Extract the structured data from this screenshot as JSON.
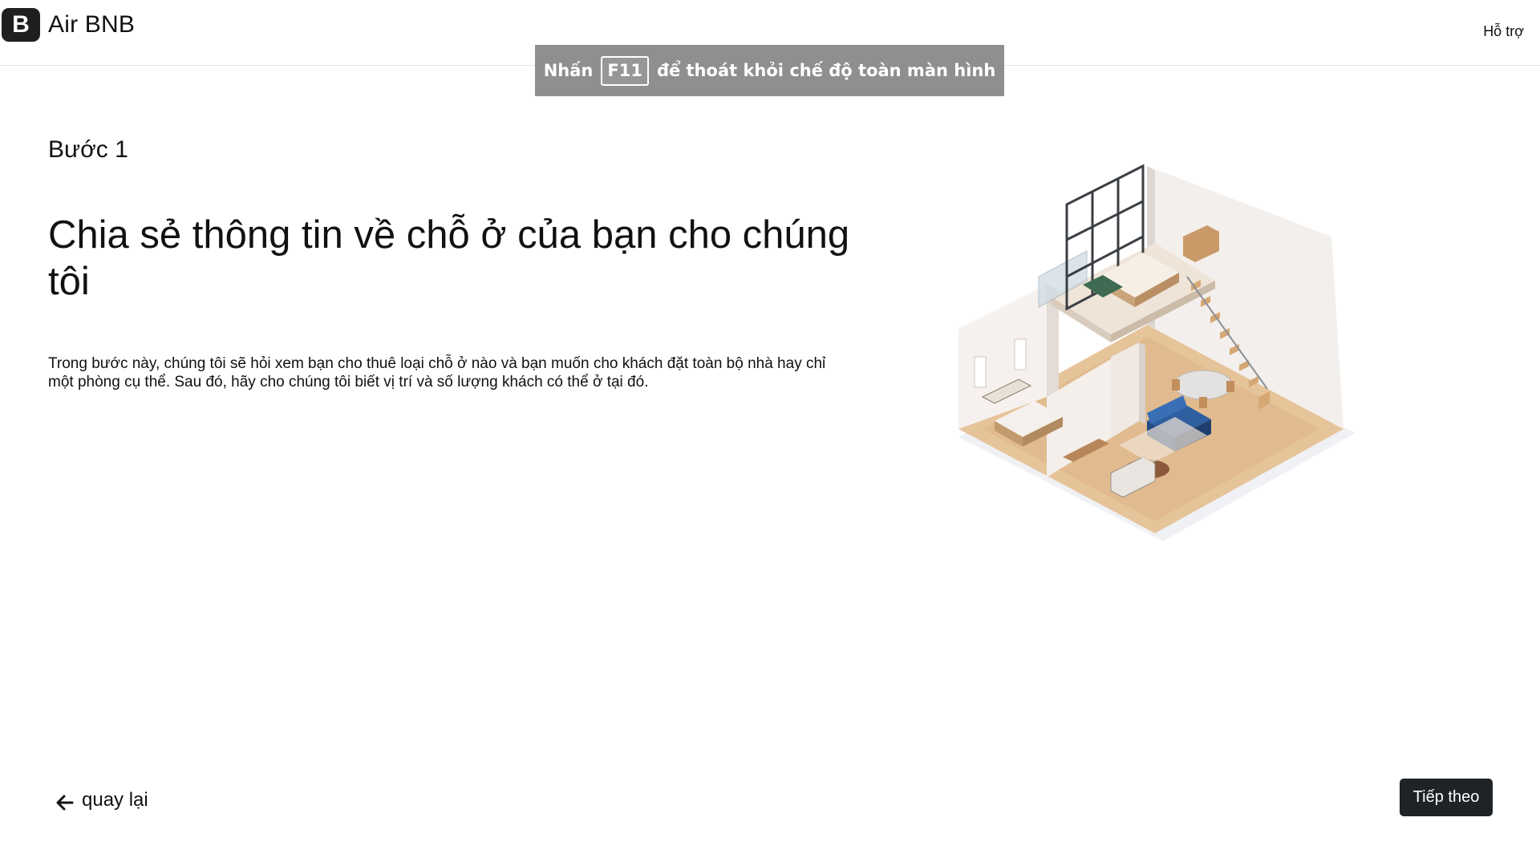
{
  "header": {
    "logo_letter": "B",
    "brand_name": "Air BNB",
    "support_label": "Hỗ trợ"
  },
  "fullscreen_toast": {
    "prefix": "Nhấn",
    "key": "F11",
    "suffix": "để thoát khỏi chế độ toàn màn hình"
  },
  "main": {
    "step_label": "Bước 1",
    "headline": "Chia sẻ thông tin về chỗ ở của bạn cho chúng tôi",
    "description": "Trong bước này, chúng tôi sẽ hỏi xem bạn cho thuê loại chỗ ở nào và bạn muốn cho khách đặt toàn bộ nhà hay chỉ một phòng cụ thể. Sau đó, hãy cho chúng tôi biết vị trí và số lượng khách có thể ở tại đó.",
    "illustration_icon": "isometric-house-illustration"
  },
  "footer": {
    "back_label": "quay lại",
    "back_icon": "arrow-left-icon",
    "next_label": "Tiếp theo"
  },
  "colors": {
    "toast_bg": "#8e8f91",
    "button_bg": "#1f2326",
    "logo_bg": "#1f1f1f",
    "sofa_blue": "#2f5fa0",
    "floor_wood": "#e6c49a"
  }
}
